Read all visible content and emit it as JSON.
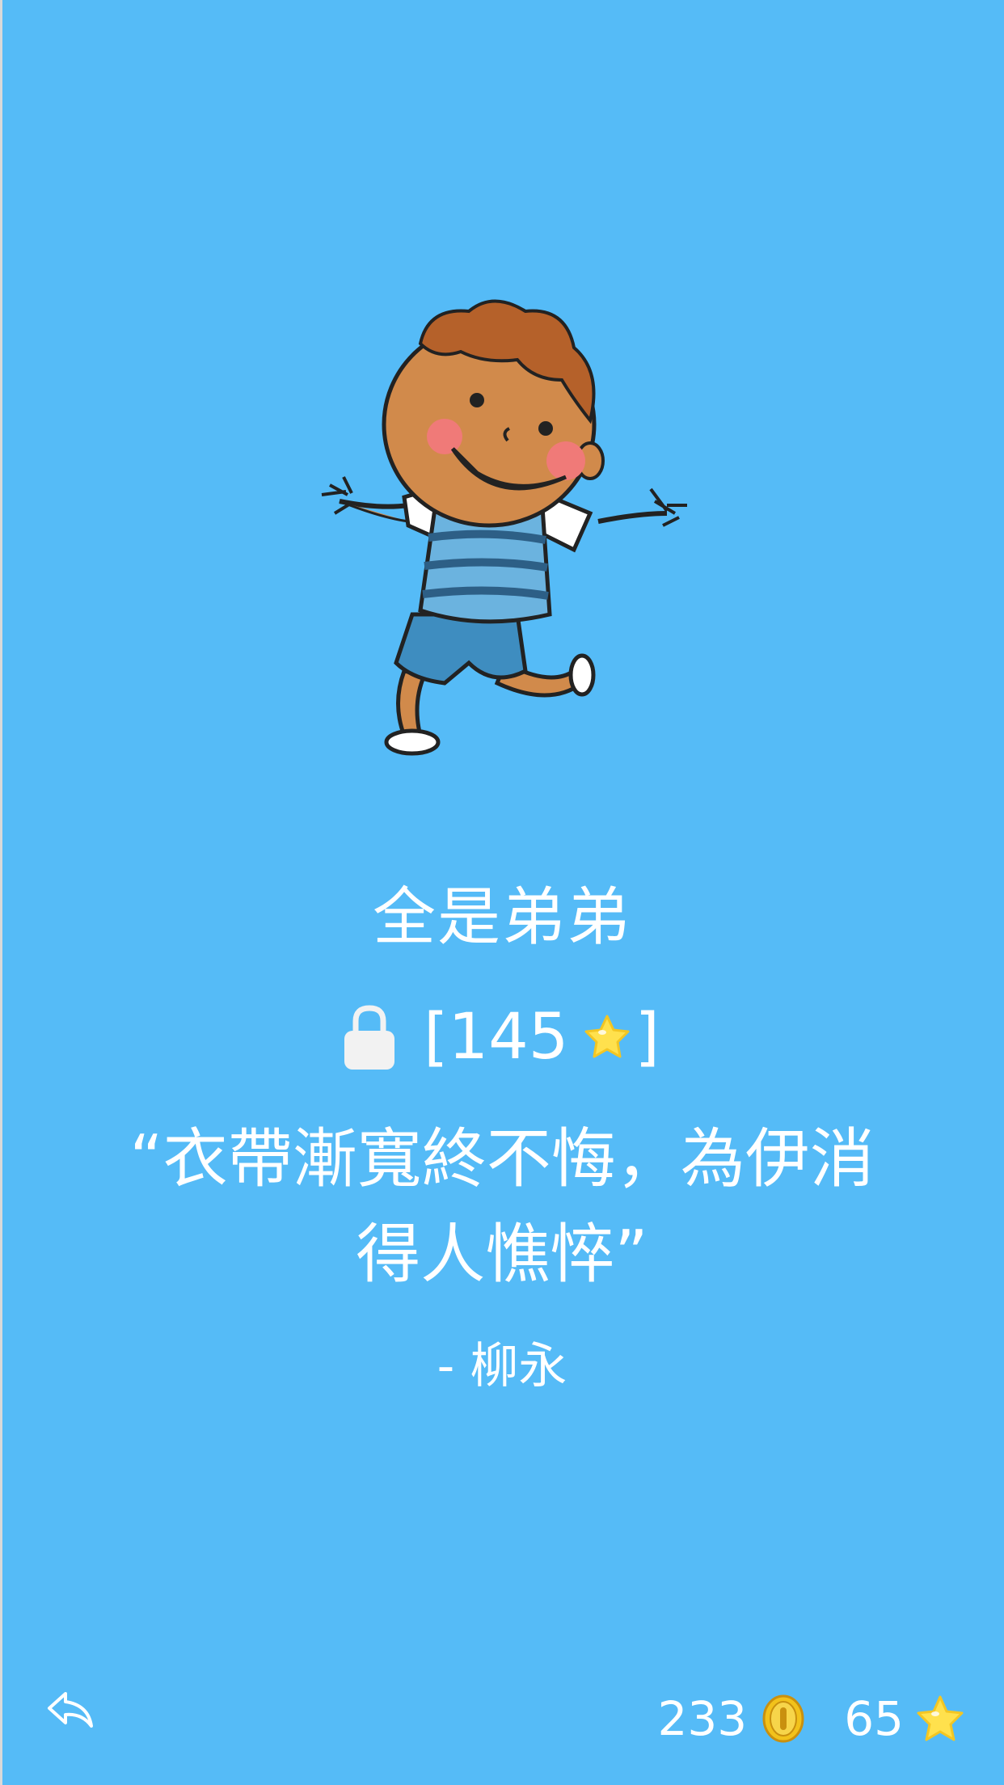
{
  "level": {
    "title": "全是弟弟",
    "unlock_prefix": "[",
    "unlock_stars": "145",
    "unlock_suffix": "]",
    "quote_line1": "“衣帶漸寬終不悔，為伊消",
    "quote_line2": "得人憔悴”",
    "author": "- 柳永"
  },
  "footer": {
    "coins": "233",
    "stars": "65"
  },
  "colors": {
    "background": "#55bbf7",
    "text": "#ffffff",
    "star": "#ffe14d",
    "coin": "#f2c21b"
  },
  "icons": {
    "back": "reply-arrow-icon",
    "lock": "lock-icon",
    "star": "star-icon",
    "coin": "coin-icon"
  }
}
